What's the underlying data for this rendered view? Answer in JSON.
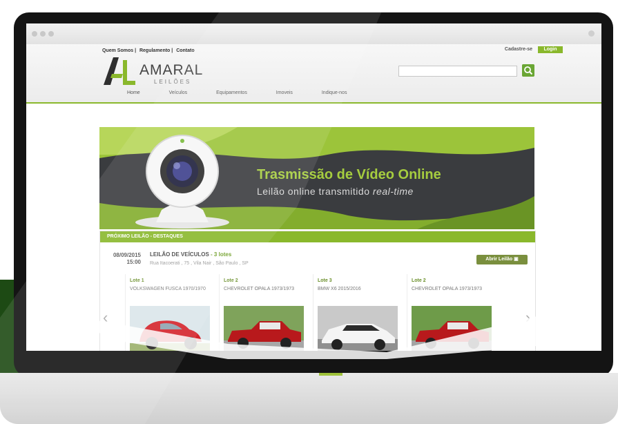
{
  "site": {
    "toplinks": [
      "Quem Somos |",
      "Regulamento |",
      "Contato"
    ],
    "signup": "Cadastre-se",
    "login": "Login",
    "logo_name": "AMARAL",
    "logo_sub": "LEILÕES",
    "nav": [
      "Home",
      "Veículos",
      "Equipamentos",
      "Imoveis",
      "Indique-nos"
    ]
  },
  "hero": {
    "title": "Trasmissão de Vídeo Online",
    "subtitle_plain": "Leilão online transmitido ",
    "subtitle_italic": "real-time"
  },
  "auction": {
    "bar": "PRÓXIMO LEILÃO - DESTAQUES",
    "date": "08/09/2015",
    "time": "15:00",
    "title": "LEILÃO DE VEÍCULOS",
    "count": "- 3 lotes",
    "address": "Rua Itacoerati , 75 , Vila Nair , São Paulo , SP",
    "open_button": "Abrir Leilão",
    "lots": [
      {
        "title": "Lote 1",
        "name": "VOLKSWAGEN FUSCA 1970/1970"
      },
      {
        "title": "Lote 2",
        "name": "CHEVROLET OPALA 1973/1973"
      },
      {
        "title": "Lote 3",
        "name": "BMW X6 2015/2016"
      },
      {
        "title": "Lote 2",
        "name": "CHEVROLET OPALA 1973/1973"
      }
    ]
  },
  "colors": {
    "accent": "#8ab82c",
    "dark": "#3a3c3f"
  }
}
